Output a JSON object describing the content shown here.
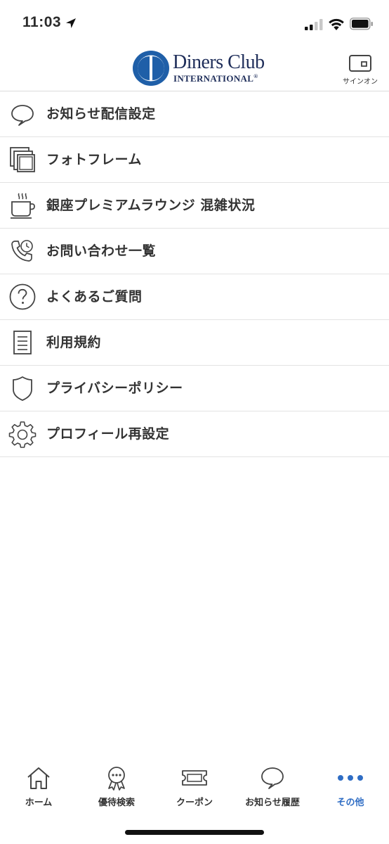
{
  "status_bar": {
    "time": "11:03"
  },
  "header": {
    "logo_line1": "Diners Club",
    "logo_line2": "INTERNATIONAL",
    "logo_registered": "®",
    "signin_label": "サインオン"
  },
  "menu": {
    "items": [
      {
        "label": "お知らせ配信設定",
        "icon": "speech-bubble-icon"
      },
      {
        "label": "フォトフレーム",
        "icon": "photo-frame-icon"
      },
      {
        "label": "銀座プレミアムラウンジ  混雑状況",
        "icon": "coffee-cup-icon"
      },
      {
        "label": "お問い合わせ一覧",
        "icon": "phone-clock-icon"
      },
      {
        "label": "よくあるご質問",
        "icon": "question-icon"
      },
      {
        "label": "利用規約",
        "icon": "document-icon"
      },
      {
        "label": "プライバシーポリシー",
        "icon": "shield-icon"
      },
      {
        "label": "プロフィール再設定",
        "icon": "gear-icon"
      }
    ]
  },
  "tabbar": {
    "active_color": "#2f6dc4",
    "tabs": [
      {
        "label": "ホーム",
        "icon": "home-icon"
      },
      {
        "label": "優待検索",
        "icon": "award-ribbon-icon"
      },
      {
        "label": "クーポン",
        "icon": "ticket-icon"
      },
      {
        "label": "お知らせ履歴",
        "icon": "speech-bubble-icon"
      },
      {
        "label": "その他",
        "icon": "more-dots-icon",
        "active": true
      }
    ]
  }
}
